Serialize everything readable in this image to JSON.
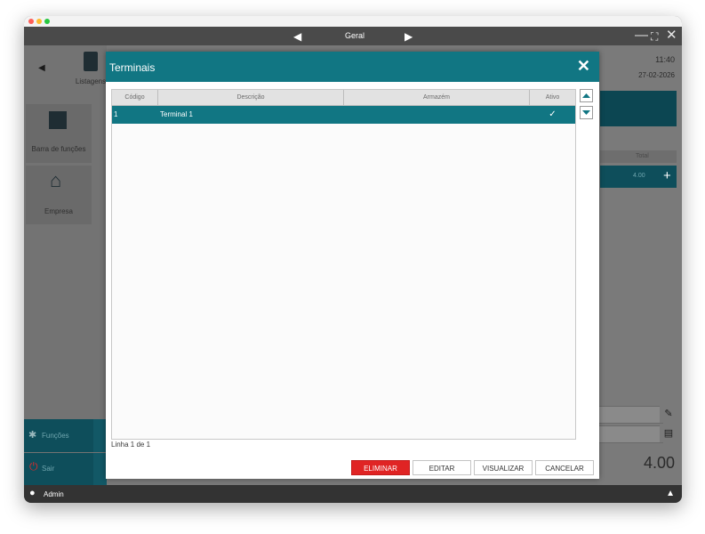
{
  "app": {
    "header_title": "Geral",
    "time": "11:40",
    "date": "27-02-2026",
    "user": "Admin"
  },
  "background": {
    "listagens_label": "Listagens",
    "barra_label": "Barra de funções",
    "empresa_label": "Empresa",
    "funcoes_label": "Funções",
    "sair_label": "Sair",
    "total_header": "Total",
    "line_total": "4.00",
    "grand_total": "4.00"
  },
  "modal": {
    "title": "Terminais",
    "columns": {
      "codigo": "Código",
      "descricao": "Descrição",
      "armazem": "Armazém",
      "ativo": "Ativo"
    },
    "rows": [
      {
        "codigo": "1",
        "descricao": "Terminal 1",
        "armazem": "",
        "ativo": "✓"
      }
    ],
    "status": "Linha 1 de 1",
    "buttons": {
      "eliminar": "ELIMINAR",
      "editar": "EDITAR",
      "visualizar": "VISUALIZAR",
      "cancelar": "CANCELAR"
    }
  },
  "colors": {
    "teal": "#117683",
    "delete_red": "#e02424"
  }
}
